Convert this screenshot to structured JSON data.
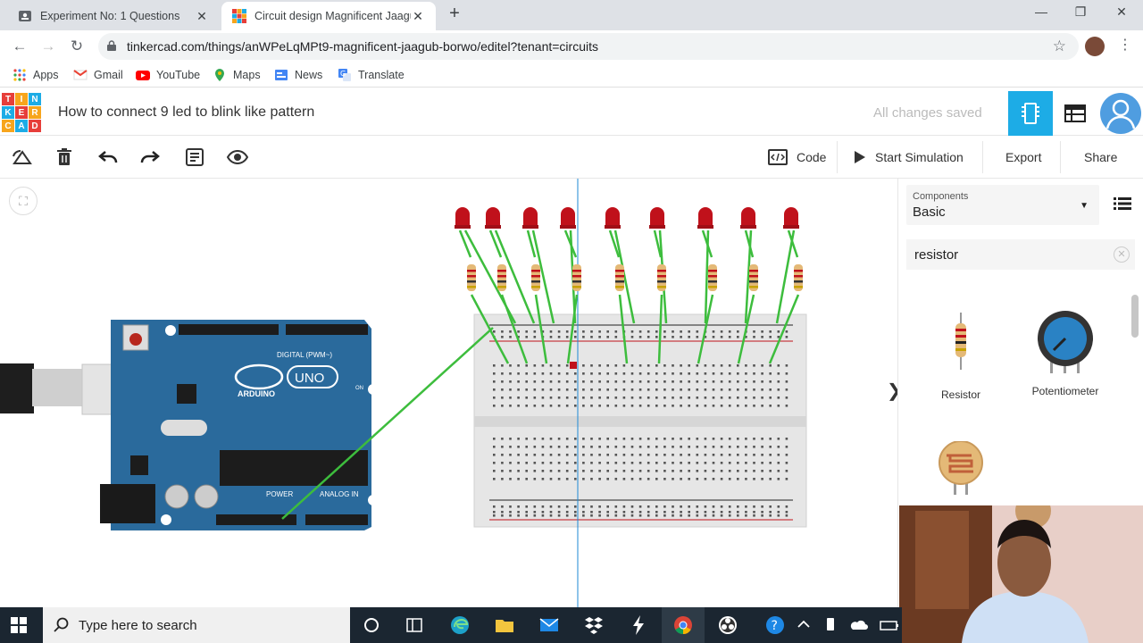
{
  "browser": {
    "tabs": [
      {
        "title": "Experiment No: 1 Questions",
        "active": false
      },
      {
        "title": "Circuit design Magnificent Jaagub",
        "active": true
      }
    ],
    "url": "tinkercad.com/things/anWPeLqMPt9-magnificent-jaagub-borwo/editel?tenant=circuits",
    "bookmarks": [
      "Apps",
      "Gmail",
      "YouTube",
      "Maps",
      "News",
      "Translate"
    ]
  },
  "app": {
    "logo_letters": [
      "T",
      "I",
      "N",
      "K",
      "E",
      "R",
      "C",
      "A",
      "D"
    ],
    "project_title": "How to connect 9 led to blink like pattern",
    "save_status": "All changes saved"
  },
  "toolbar": {
    "code_label": "Code",
    "start_sim_label": "Start Simulation",
    "export_label": "Export",
    "share_label": "Share"
  },
  "panel": {
    "components_label": "Components",
    "components_value": "Basic",
    "search_value": "resistor",
    "items": [
      "Resistor",
      "Potentiometer"
    ]
  },
  "board": {
    "brand": "ARDUINO",
    "model": "UNO",
    "digital_label": "DIGITAL (PWM~)",
    "power_label": "POWER",
    "analog_label": "ANALOG IN",
    "on_label": "ON"
  },
  "taskbar": {
    "search_placeholder": "Type here to search"
  },
  "colors": {
    "accent": "#1dace6",
    "wire": "#3dbd3d",
    "led": "#c0111b",
    "arduino": "#2a6a9c"
  }
}
